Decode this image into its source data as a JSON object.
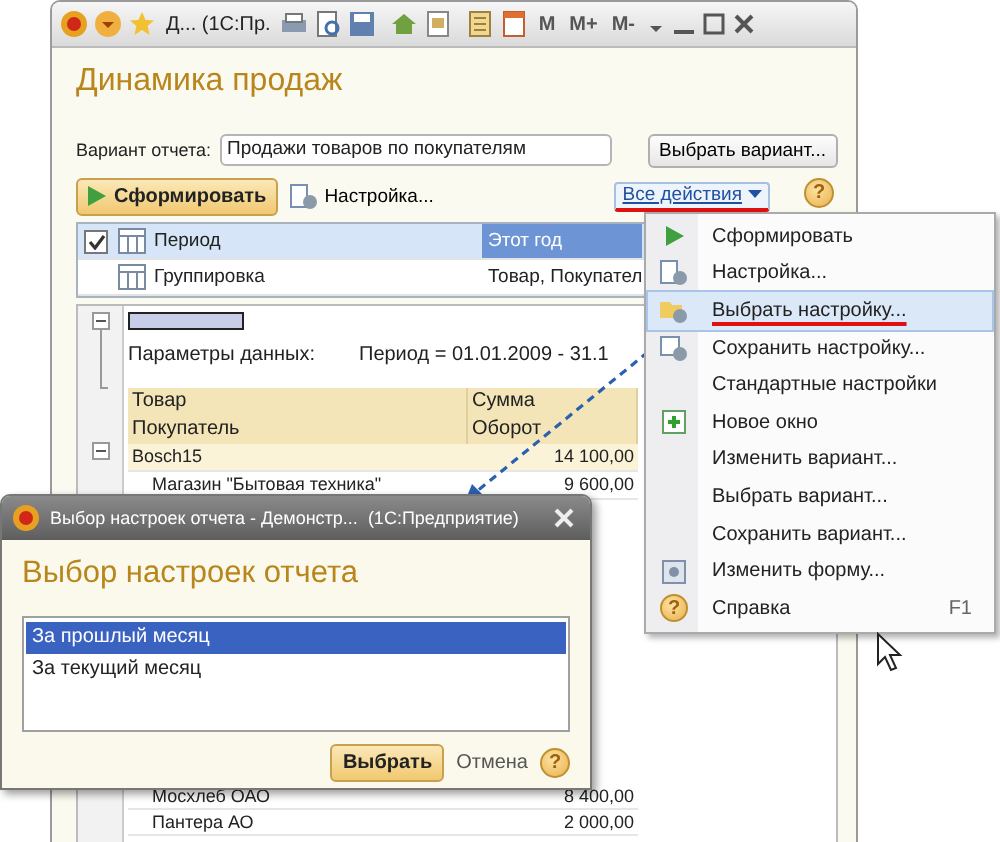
{
  "main_window": {
    "title": "Д... (1С:Пр.",
    "memory_buttons": [
      "M",
      "M+",
      "M-"
    ],
    "heading": "Динамика продаж",
    "variant_label": "Вариант отчета:",
    "variant_value": "Продажи товаров по покупателям",
    "choose_variant_button": "Выбрать вариант...",
    "help_icon": "?",
    "run_button": "Сформировать",
    "settings_button": "Настройка...",
    "all_actions_button": {
      "label": "Все действия",
      "emphasized": true
    },
    "settings_rows": [
      {
        "kind": "checkbox",
        "checked": true,
        "label": "Период",
        "value": "Этот год",
        "selected": true
      },
      {
        "kind": "plain",
        "label": "Группировка",
        "value": "Товар, Покупател",
        "selected": false
      }
    ],
    "report": {
      "params_label": "Параметры данных:",
      "params_value": "Период = 01.01.2009 - 31.1",
      "columns": [
        {
          "line1": "Товар",
          "line2": "Покупатель"
        },
        {
          "line1": "Сумма",
          "line2": "Оборот"
        }
      ],
      "rows_top": [
        {
          "kind": "group",
          "name": "Bosch15",
          "amount": "14 100,00"
        },
        {
          "kind": "item",
          "name": "Магазин \"Бытовая техника\"",
          "amount": "9 600,00"
        }
      ],
      "rows_bottom": [
        {
          "kind": "item",
          "name": "Мосхлеб ОАО",
          "amount": "8 400,00"
        },
        {
          "kind": "item",
          "name": "Пантера АО",
          "amount": "2 000,00"
        }
      ]
    }
  },
  "actions_menu": [
    {
      "kind": "run",
      "label": "Сформировать",
      "selected": false
    },
    {
      "kind": "settings",
      "label": "Настройка...",
      "selected": false
    },
    {
      "kind": "load",
      "label": "Выбрать настройку...",
      "selected": true
    },
    {
      "kind": "save",
      "label": "Сохранить настройку...",
      "selected": false
    },
    {
      "kind": "plain",
      "label": "Стандартные настройки",
      "selected": false
    },
    {
      "kind": "window",
      "label": "Новое окно",
      "selected": false
    },
    {
      "kind": "plain",
      "label": "Изменить вариант...",
      "selected": false
    },
    {
      "kind": "plain",
      "label": "Выбрать вариант...",
      "selected": false
    },
    {
      "kind": "plain",
      "label": "Сохранить вариант...",
      "selected": false
    },
    {
      "kind": "form",
      "label": "Изменить форму...",
      "selected": false
    },
    {
      "kind": "help",
      "icon_text": "?",
      "label": "Справка",
      "shortcut": "F1",
      "selected": false
    }
  ],
  "dialog": {
    "title": "Выбор настроек отчета - Демонстр...",
    "app_name": "(1С:Предприятие)",
    "heading": "Выбор настроек отчета",
    "items": [
      {
        "label": "За прошлый месяц",
        "selected": true
      },
      {
        "label": "За текущий месяц",
        "selected": false
      }
    ],
    "choose_button": "Выбрать",
    "cancel_link": "Отмена",
    "help_icon": "?"
  }
}
